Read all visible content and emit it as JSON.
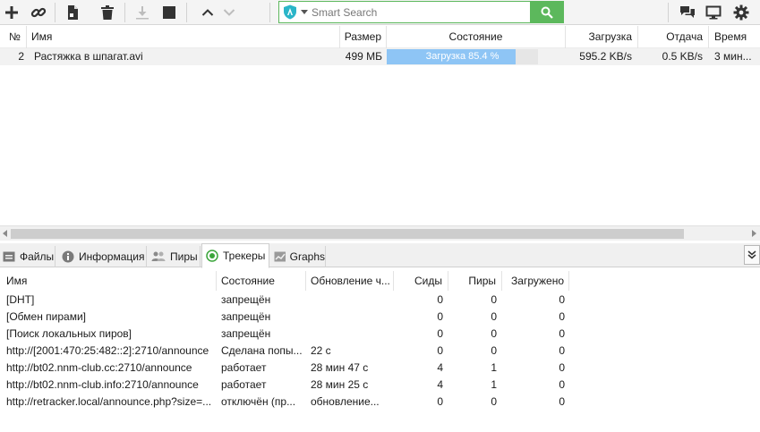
{
  "toolbar": {
    "icons": [
      "add-icon",
      "link-icon",
      "create-file-icon",
      "delete-icon",
      "download-icon",
      "stop-icon",
      "move-up-icon",
      "move-down-icon",
      "chat-icon",
      "remote-icon",
      "settings-icon"
    ]
  },
  "search": {
    "placeholder": "Smart Search",
    "value": "",
    "accent": "#5cb85c"
  },
  "torrents": {
    "columns": [
      "№",
      "Имя",
      "Размер",
      "Состояние",
      "Загрузка",
      "Отдача",
      "Время"
    ],
    "rows": [
      {
        "num": "2",
        "name": "Растяжка в шпагат.avi",
        "size": "499 МБ",
        "status": "Загрузка 85.4 %",
        "progress": 0.854,
        "download": "595.2 KB/s",
        "upload": "0.5 KB/s",
        "time": "3 мин..."
      }
    ]
  },
  "tabs": [
    {
      "label": "Файлы",
      "icon": "files-icon"
    },
    {
      "label": "Информация",
      "icon": "info-icon"
    },
    {
      "label": "Пиры",
      "icon": "peers-icon"
    },
    {
      "label": "Трекеры",
      "icon": "trackers-icon",
      "active": true
    },
    {
      "label": "Graphs",
      "icon": "graphs-icon"
    }
  ],
  "trackers": {
    "columns": [
      "Имя",
      "Состояние",
      "Обновление ч...",
      "Сиды",
      "Пиры",
      "Загружено"
    ],
    "rows": [
      {
        "name": "[DHT]",
        "status": "запрещён",
        "update": "",
        "seeds": "0",
        "peers": "0",
        "downloaded": "0"
      },
      {
        "name": "[Обмен пирами]",
        "status": "запрещён",
        "update": "",
        "seeds": "0",
        "peers": "0",
        "downloaded": "0"
      },
      {
        "name": "[Поиск локальных пиров]",
        "status": "запрещён",
        "update": "",
        "seeds": "0",
        "peers": "0",
        "downloaded": "0"
      },
      {
        "name": "http://[2001:470:25:482::2]:2710/announce",
        "status": "Сделана попы...",
        "update": "22 с",
        "seeds": "0",
        "peers": "0",
        "downloaded": "0"
      },
      {
        "name": "http://bt02.nnm-club.cc:2710/announce",
        "status": "работает",
        "update": "28 мин 47 с",
        "seeds": "4",
        "peers": "1",
        "downloaded": "0"
      },
      {
        "name": "http://bt02.nnm-club.info:2710/announce",
        "status": "работает",
        "update": "28 мин 25 с",
        "seeds": "4",
        "peers": "1",
        "downloaded": "0"
      },
      {
        "name": "http://retracker.local/announce.php?size=...",
        "status": "отключён (пр...",
        "update": "обновление...",
        "seeds": "0",
        "peers": "0",
        "downloaded": "0"
      }
    ]
  }
}
